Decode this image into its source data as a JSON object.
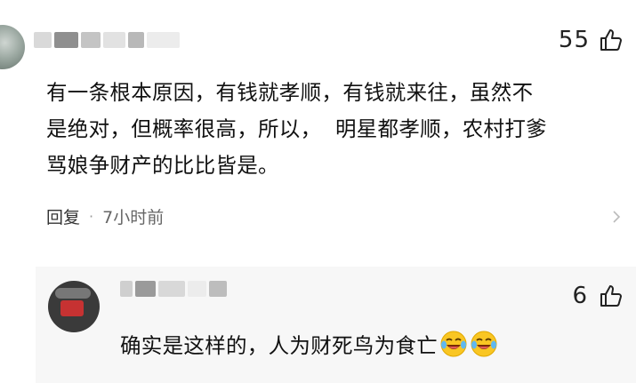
{
  "comment": {
    "like_count": "55",
    "text": "有一条根本原因，有钱就孝顺，有钱就来往，虽然不\n是绝对，但概率很高，所以，  明星都孝顺，农村打爹\n骂娘争财产的比比皆是。",
    "reply_label": "回复",
    "separator": "·",
    "timestamp": "7小时前"
  },
  "reply": {
    "like_count": "6",
    "text": "确实是这样的，人为财死鸟为食亡",
    "emojis": [
      "laughing-crying-emoji",
      "laughing-crying-emoji"
    ]
  },
  "colors": {
    "background": "#ffffff",
    "reply_background": "#f7f7f7",
    "text": "#111111",
    "meta": "#666666"
  }
}
